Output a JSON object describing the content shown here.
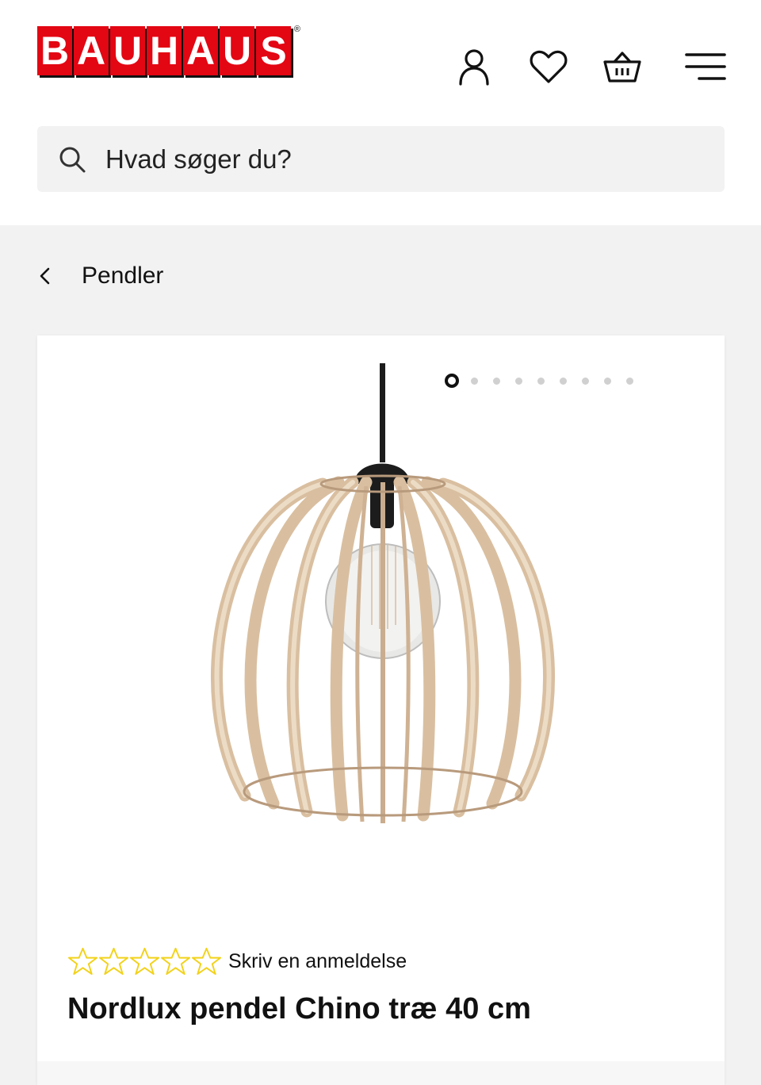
{
  "header": {
    "logo_letters": [
      "B",
      "A",
      "U",
      "H",
      "A",
      "U",
      "S"
    ],
    "logo_registered": "®",
    "icons": [
      "account-icon",
      "wishlist-heart-icon",
      "basket-icon",
      "menu-icon"
    ]
  },
  "search": {
    "placeholder": "Hvad søger du?"
  },
  "breadcrumb": {
    "label": "Pendler"
  },
  "product": {
    "image_dots_total": 9,
    "image_dots_active": 1,
    "rating_stars": 5,
    "rating_value": 0,
    "review_link": "Skriv en anmeldelse",
    "title": "Nordlux pendel Chino træ 40 cm"
  },
  "colors": {
    "brand_red": "#e30613",
    "star_outline": "#f2d21b",
    "wood": "#e6cfb4"
  }
}
